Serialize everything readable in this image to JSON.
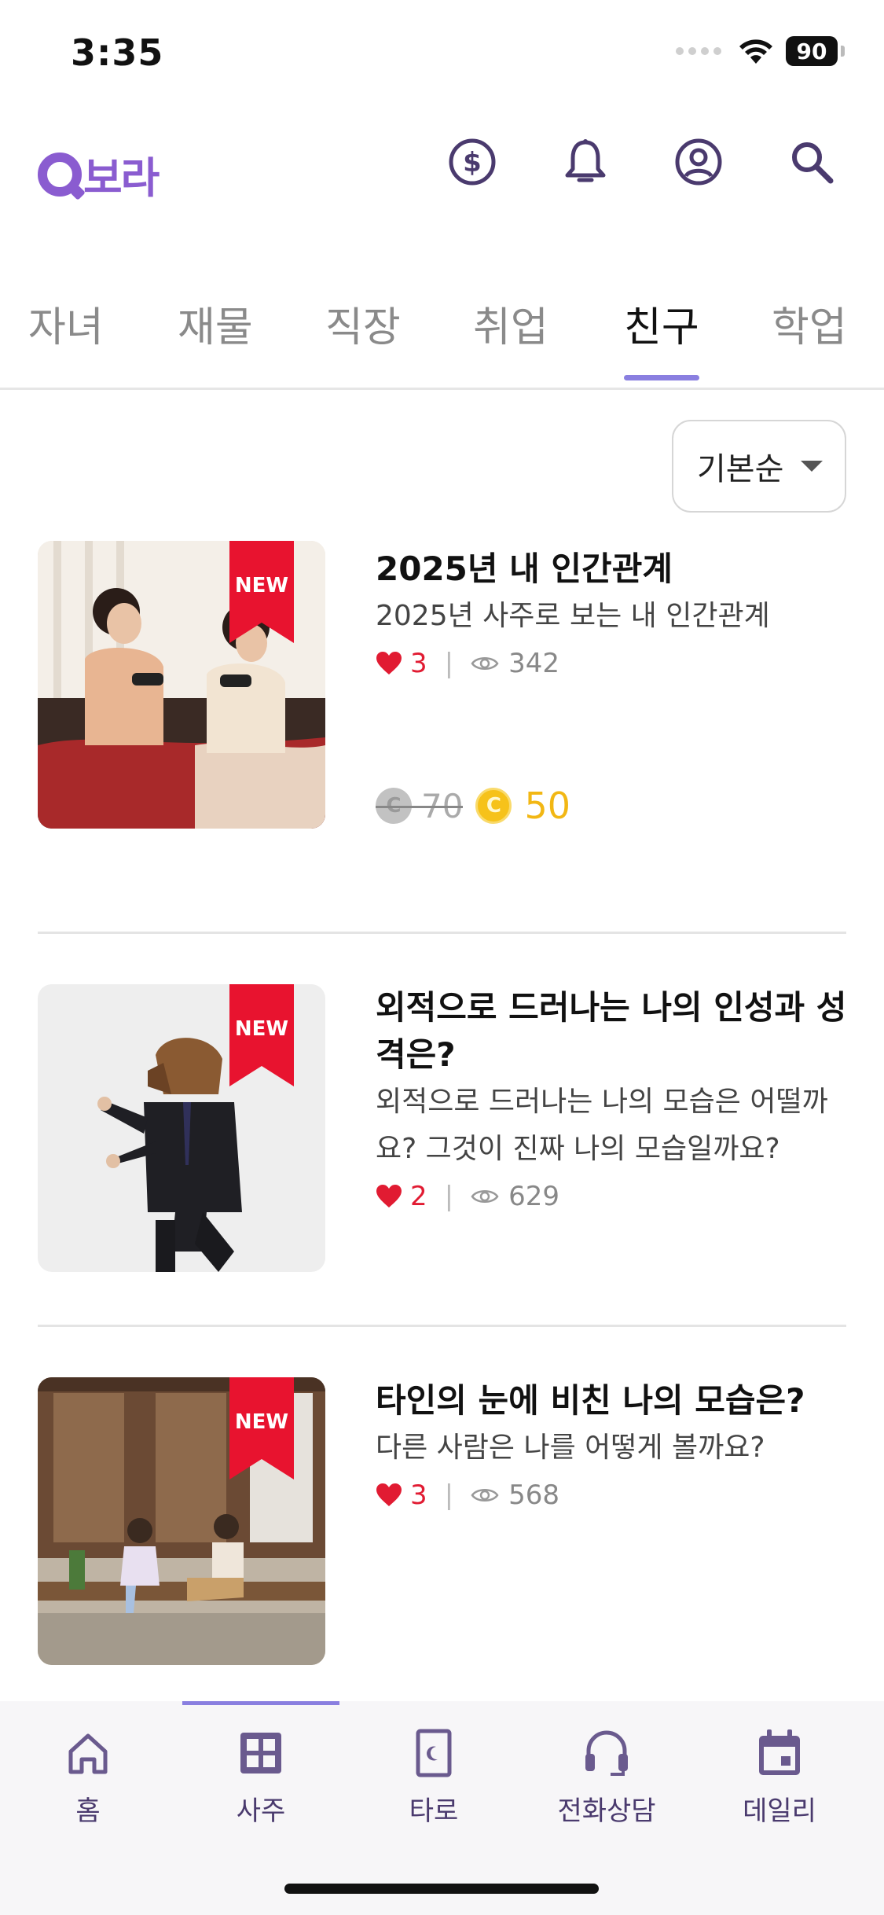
{
  "status_bar": {
    "time": "3:35",
    "battery": "90"
  },
  "header": {
    "logo_text": "보라",
    "icons": [
      "coin-icon",
      "bell-icon",
      "user-icon",
      "search-icon"
    ]
  },
  "tabs": [
    {
      "label": "자녀"
    },
    {
      "label": "재물"
    },
    {
      "label": "직장"
    },
    {
      "label": "취업"
    },
    {
      "label": "친구",
      "active": true
    },
    {
      "label": "학업"
    }
  ],
  "sort": {
    "label": "기본순"
  },
  "items": [
    {
      "badge": "NEW",
      "title": "2025년 내 인간관계",
      "subtitle": "2025년 사주로 보는 내 인간관계",
      "likes": "3",
      "views": "342",
      "old_price": "70",
      "price": "50",
      "coin_symbol": "C"
    },
    {
      "badge": "NEW",
      "title": "외적으로 드러나는 나의 인성과 성격은?",
      "subtitle": "외적으로 드러나는 나의 모습은 어떨까요? 그것이 진짜 나의 모습일까요?",
      "likes": "2",
      "views": "629"
    },
    {
      "badge": "NEW",
      "title": "타인의 눈에 비친 나의 모습은?",
      "subtitle": "다른 사람은 나를 어떻게 볼까요?",
      "likes": "3",
      "views": "568"
    }
  ],
  "bottom_nav": [
    {
      "label": "홈",
      "icon": "home-icon"
    },
    {
      "label": "사주",
      "icon": "saju-grid-icon",
      "active": true
    },
    {
      "label": "타로",
      "icon": "tarot-card-icon"
    },
    {
      "label": "전화상담",
      "icon": "headset-icon"
    },
    {
      "label": "데일리",
      "icon": "calendar-icon"
    }
  ],
  "colors": {
    "accent": "#8a5cd0",
    "tab_indicator": "#8a7fe0",
    "badge": "#e8132f",
    "heart": "#e11b32",
    "coin_gold": "#f6c21a",
    "nav_text": "#4a3a6e"
  }
}
